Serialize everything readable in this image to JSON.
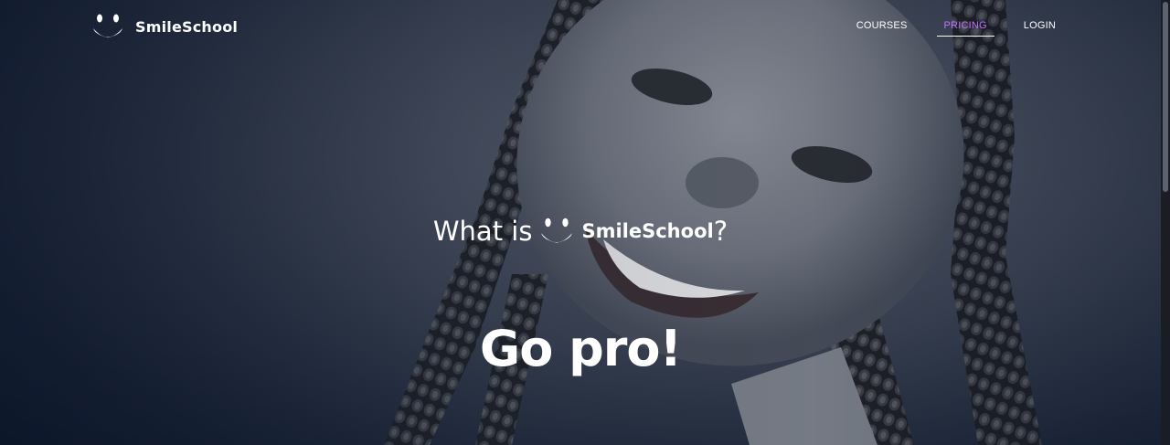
{
  "brand": {
    "name": "SmileSchool",
    "logo_icon": "smile-logo-icon"
  },
  "nav": {
    "items": [
      {
        "label": "COURSES",
        "active": false
      },
      {
        "label": "PRICING",
        "active": true
      },
      {
        "label": "LOGIN",
        "active": false
      }
    ],
    "active_color": "#c271ff"
  },
  "hero": {
    "question_prefix": "What is",
    "question_brand": "SmileSchool",
    "question_suffix": "?",
    "headline": "Go pro!"
  }
}
